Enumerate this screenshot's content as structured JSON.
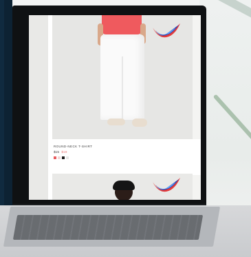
{
  "product": {
    "name": "ROUND-NECK T-SHIRT",
    "price": "$15",
    "old_price": "$19"
  },
  "swatches": [
    {
      "color": "#e85b5f"
    },
    {
      "color": "#f4d7d7"
    },
    {
      "color": "#1e1e1e"
    },
    {
      "color": "#e7e7e7"
    }
  ],
  "icons": {
    "brand_logo": "wave-logo-icon"
  }
}
